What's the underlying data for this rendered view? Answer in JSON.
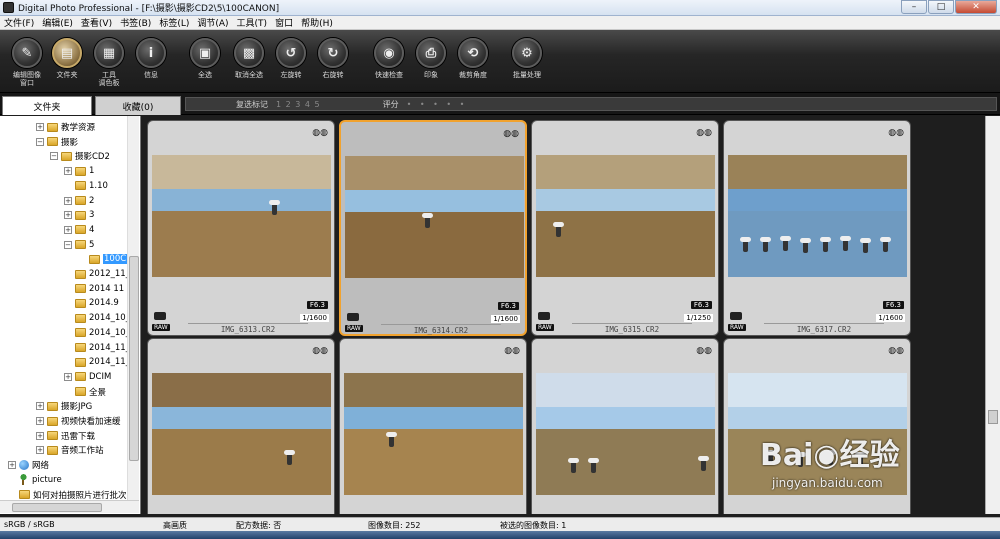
{
  "window": {
    "title": "Digital Photo Professional - [F:\\摄影\\摄影CD2\\5\\100CANON]",
    "minimize": "–",
    "maximize": "□",
    "close": "✕"
  },
  "menu": [
    "文件(F)",
    "编辑(E)",
    "查看(V)",
    "书签(B)",
    "标签(L)",
    "调节(A)",
    "工具(T)",
    "窗口",
    "帮助(H)"
  ],
  "toolbar": [
    {
      "label": "编辑图像\n窗口",
      "icon": "edit-image-window-icon",
      "glyph": "✎"
    },
    {
      "label": "文件夹",
      "icon": "folder-icon",
      "glyph": "▤",
      "active": true
    },
    {
      "label": "工具\n调色板",
      "icon": "tool-palette-icon",
      "glyph": "▦"
    },
    {
      "label": "信息",
      "icon": "info-icon",
      "glyph": "i"
    },
    {
      "label": "全选",
      "icon": "select-all-icon",
      "glyph": "▣"
    },
    {
      "label": "取消全选",
      "icon": "deselect-all-icon",
      "glyph": "▩"
    },
    {
      "label": "左旋转",
      "icon": "rotate-left-icon",
      "glyph": "↺"
    },
    {
      "label": "右旋转",
      "icon": "rotate-right-icon",
      "glyph": "↻"
    },
    {
      "label": "快速检查",
      "icon": "quick-check-icon",
      "glyph": "◉"
    },
    {
      "label": "印象",
      "icon": "print-icon",
      "glyph": "⎙"
    },
    {
      "label": "裁剪角度",
      "icon": "crop-angle-icon",
      "glyph": "⟲"
    },
    {
      "label": "批量处理",
      "icon": "batch-process-icon",
      "glyph": "⚙"
    }
  ],
  "tabs": {
    "folder": "文件夹",
    "favorites": "收藏(0)"
  },
  "rating_bar": {
    "check_mark_label": "复选标记",
    "check_numbers": "1 2 3 4 5",
    "rating_label": "评分",
    "rating_dots": "• • • • •"
  },
  "tree": [
    {
      "label": "教学资源",
      "toggle": "+"
    },
    {
      "label": "摄影",
      "toggle": "−"
    },
    {
      "label": "摄影CD2",
      "toggle": "−"
    },
    {
      "label": "1",
      "toggle": "+"
    },
    {
      "label": "1.10",
      "toggle": ""
    },
    {
      "label": "2",
      "toggle": "+"
    },
    {
      "label": "3",
      "toggle": "+"
    },
    {
      "label": "4",
      "toggle": "+"
    },
    {
      "label": "5",
      "toggle": "−"
    },
    {
      "label": "100C",
      "toggle": "",
      "selected": true
    },
    {
      "label": "2012_11_",
      "toggle": ""
    },
    {
      "label": "2014 11",
      "toggle": ""
    },
    {
      "label": "2014.9",
      "toggle": ""
    },
    {
      "label": "2014_10_",
      "toggle": ""
    },
    {
      "label": "2014_10_",
      "toggle": ""
    },
    {
      "label": "2014_11_",
      "toggle": ""
    },
    {
      "label": "2014_11_",
      "toggle": ""
    },
    {
      "label": "DCIM",
      "toggle": "+"
    },
    {
      "label": "全景",
      "toggle": ""
    },
    {
      "label": "摄影JPG",
      "toggle": "+"
    },
    {
      "label": "视频快看加速缓",
      "toggle": "+"
    },
    {
      "label": "迅雷下载",
      "toggle": "+"
    },
    {
      "label": "音频工作站",
      "toggle": "+"
    },
    {
      "label": "网络",
      "toggle": "+"
    },
    {
      "label": "picture",
      "toggle": ""
    },
    {
      "label": "如何对拍摄照片进行批次",
      "toggle": ""
    }
  ],
  "thumbnails": [
    {
      "file": "IMG_6313.CR2",
      "fstop": "F6.3",
      "shutter": "1/1600",
      "raw": "RAW",
      "selected": false
    },
    {
      "file": "IMG_6314.CR2",
      "fstop": "F6.3",
      "shutter": "1/1600",
      "raw": "RAW",
      "selected": true
    },
    {
      "file": "IMG_6315.CR2",
      "fstop": "F6.3",
      "shutter": "1/1250",
      "raw": "RAW",
      "selected": false
    },
    {
      "file": "IMG_6317.CR2",
      "fstop": "F6.3",
      "shutter": "1/1600",
      "raw": "RAW",
      "selected": false
    },
    {
      "file": "",
      "fstop": "",
      "shutter": "",
      "raw": "",
      "selected": false
    },
    {
      "file": "",
      "fstop": "",
      "shutter": "",
      "raw": "",
      "selected": false
    },
    {
      "file": "",
      "fstop": "",
      "shutter": "",
      "raw": "",
      "selected": false
    },
    {
      "file": "",
      "fstop": "",
      "shutter": "",
      "raw": "",
      "selected": false
    }
  ],
  "status": {
    "color_space": "sRGB / sRGB",
    "quality": "高画质",
    "recipe": "配方数据: 否",
    "image_count": "图像数目: 252",
    "selected_count": "被选的图像数目: 1"
  },
  "watermark": {
    "logo": "Bai◉经验",
    "url": "jingyan.baidu.com"
  }
}
